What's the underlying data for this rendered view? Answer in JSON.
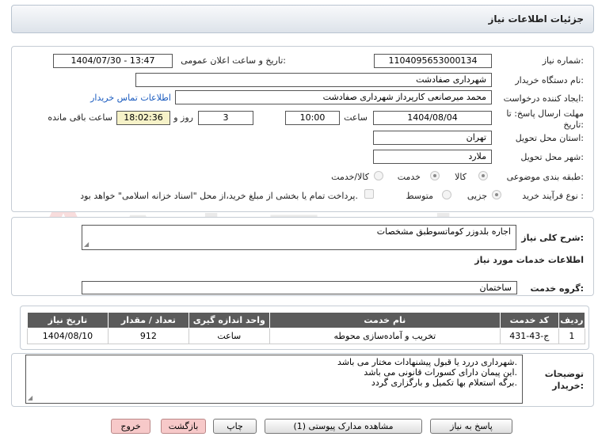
{
  "header": {
    "title": "جزئیات اطلاعات نیاز"
  },
  "form": {
    "need_number_label": "شماره نیاز:",
    "need_number": "1104095653000134",
    "announce_label": "تاریخ و ساعت اعلان عمومی:",
    "announce_value": "1404/07/30 - 13:47",
    "buyer_org_label": "نام دستگاه خریدار:",
    "buyer_org": "شهرداری صفادشت",
    "creator_label": "ایجاد کننده درخواست:",
    "creator": "محمد میرصانعی کارپرداز شهرداری صفادشت",
    "contact_link": "اطلاعات تماس خریدار",
    "deadline_label": "مهلت ارسال پاسخ: تا تاریخ:",
    "deadline_date": "1404/08/04",
    "time_label": "ساعت",
    "deadline_time": "10:00",
    "days_value": "3",
    "days_label": "روز و",
    "remaining_time": "18:02:36",
    "remaining_label": "ساعت باقی مانده",
    "province_label": "استان محل تحویل:",
    "province": "تهران",
    "city_label": "شهر محل تحویل:",
    "city": "ملارد",
    "category_label": "طبقه بندی موضوعی:",
    "category_options": [
      "کالا",
      "خدمت",
      "کالا/خدمت"
    ],
    "process_label": "نوع فرآیند خرید :",
    "process_options": [
      "جزیی",
      "متوسط"
    ],
    "payment_text": "پرداخت تمام یا بخشی از مبلغ خرید،از محل \"اسناد خزانه اسلامی\" خواهد بود."
  },
  "need": {
    "summary_label": "شرح کلی نیاز:",
    "summary": "اجاره بلدوزر کوماتسوطبق مشخصات",
    "services_title": "اطلاعات خدمات مورد نیاز",
    "group_label": "گروه خدمت:",
    "group": "ساختمان"
  },
  "table": {
    "headers": [
      "ردیف",
      "کد خدمت",
      "نام خدمت",
      "واحد اندازه گیری",
      "تعداد / مقدار",
      "تاریخ نیاز"
    ],
    "rows": [
      [
        "1",
        "ج-43-431",
        "تخریب و آماده‌سازی محوطه",
        "ساعت",
        "912",
        "1404/08/10"
      ]
    ]
  },
  "notes": {
    "label": "توضیحات خریدار:",
    "line1": "شهرداری دررد یا قبول پیشنهادات مختار می باشد.",
    "line2": "این پیمان دارای کسورات قانونی می باشد.",
    "line3": "برگه استعلام بها تکمیل و بارگزاری گردد."
  },
  "buttons": {
    "reply": "پاسخ به نیاز",
    "docs": "مشاهده مدارک پیوستی (1)",
    "print": "چاپ",
    "back": "بازگشت",
    "exit": "خروج"
  },
  "watermark": {
    "text": "AriaTender.net"
  },
  "colors": {
    "header_bg": "#5b5b5b",
    "highlight": "#f6f2c8",
    "link": "#1a5bbf",
    "danger_btn": "#f7c9c9"
  }
}
